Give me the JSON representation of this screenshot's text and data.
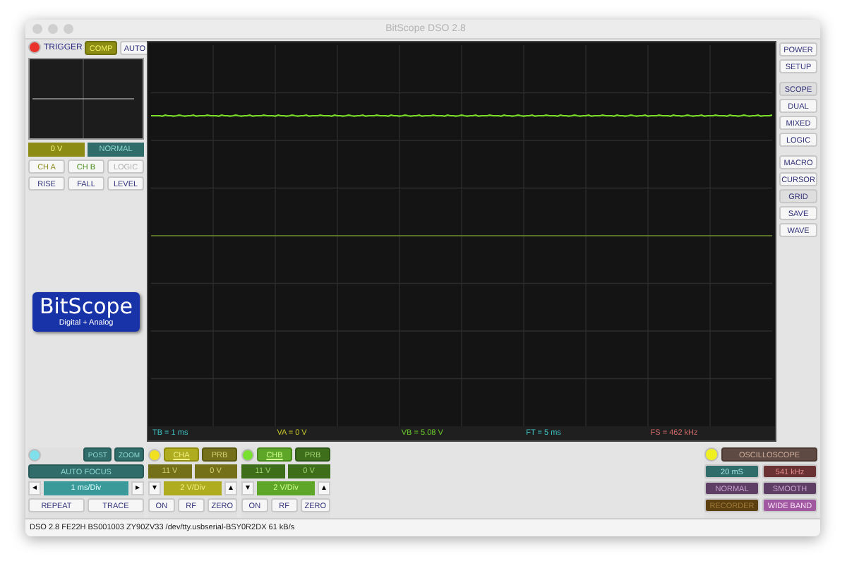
{
  "window": {
    "title": "BitScope DSO 2.8"
  },
  "trigger": {
    "label": "TRIGGER",
    "color": "#e8322b",
    "buttons": [
      {
        "label": "COMP",
        "selected": true
      },
      {
        "label": "AUTO",
        "selected": false
      }
    ],
    "level": "0 V",
    "mode": "NORMAL",
    "sources": [
      {
        "label": "CH A",
        "disabled": false
      },
      {
        "label": "CH B",
        "disabled": false
      },
      {
        "label": "LOGIC",
        "disabled": true
      }
    ],
    "edges": [
      "RISE",
      "FALL",
      "LEVEL"
    ]
  },
  "logo": {
    "title": "BitScope",
    "subtitle": "Digital + Analog"
  },
  "display": {
    "readouts": [
      {
        "text": "TB = 1 ms",
        "color": "#3fc4c4"
      },
      {
        "text": "VA = 0 V",
        "color": "#c8c828"
      },
      {
        "text": "VB = 5.08 V",
        "color": "#6ac82a"
      },
      {
        "text": "FT = 5 ms",
        "color": "#3fc4c4"
      },
      {
        "text": "FS = 462 kHz",
        "color": "#d26a6a"
      }
    ]
  },
  "side_menu": [
    [
      {
        "label": "POWER",
        "selected": false
      },
      {
        "label": "SETUP",
        "selected": false
      }
    ],
    [
      {
        "label": "SCOPE",
        "selected": true
      },
      {
        "label": "DUAL",
        "selected": false
      },
      {
        "label": "MIXED",
        "selected": false
      },
      {
        "label": "LOGIC",
        "selected": false
      }
    ],
    [
      {
        "label": "MACRO",
        "selected": false
      },
      {
        "label": "CURSOR",
        "selected": false
      },
      {
        "label": "GRID",
        "selected": true
      },
      {
        "label": "SAVE",
        "selected": false
      },
      {
        "label": "WAVE",
        "selected": false
      }
    ]
  ],
  "timebase": {
    "color": "#7fe0ec",
    "post": "POST",
    "zoom": "ZOOM",
    "focus": "AUTO FOCUS",
    "rate": "1 ms/Div",
    "left": "◂",
    "right": "▸",
    "actions": [
      "REPEAT",
      "TRACE"
    ]
  },
  "channels": [
    {
      "kind": "a",
      "color": "#f0e020",
      "name": "CHA",
      "probe": "PRB",
      "range": "11 V",
      "offset": "0 V",
      "down": "▾",
      "scale": "2 V/Div",
      "up": "▴",
      "buttons": [
        "ON",
        "RF",
        "ZERO"
      ]
    },
    {
      "kind": "b",
      "color": "#78e030",
      "name": "CHB",
      "probe": "PRB",
      "range": "11 V",
      "offset": "0 V",
      "down": "▾",
      "scale": "2 V/Div",
      "up": "▴",
      "buttons": [
        "ON",
        "RF",
        "ZERO"
      ]
    }
  ],
  "mode": {
    "color": "#f0f020",
    "title": "OSCILLOSCOPE",
    "cells": [
      {
        "text": "20 mS",
        "kind": "teal"
      },
      {
        "text": "541 kHz",
        "kind": "red"
      },
      {
        "text": "NORMAL",
        "kind": "purple"
      },
      {
        "text": "SMOOTH",
        "kind": "purple"
      },
      {
        "text": "RECORDER",
        "kind": "brown"
      },
      {
        "text": "WIDE BAND",
        "kind": "pink"
      }
    ]
  },
  "status_bar": "DSO 2.8 FE22H BS001003 ZY90ZV33 /dev/tty.usbserial-BSY0R2DX 61 kB/s"
}
